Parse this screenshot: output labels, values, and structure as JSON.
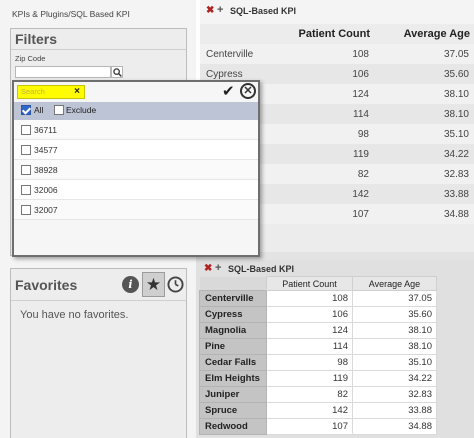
{
  "breadcrumb": "KPIs & Plugins/SQL Based KPI",
  "filters": {
    "title": "Filters",
    "zip_label": "Zip Code",
    "zip_value": ""
  },
  "popup": {
    "search_placeholder": "Search",
    "all_label": "All",
    "exclude_label": "Exclude",
    "all_checked": true,
    "exclude_checked": false,
    "items": [
      "36711",
      "34577",
      "38928",
      "32006",
      "32007"
    ]
  },
  "favorites": {
    "title": "Favorites",
    "empty_text": "You have no favorites."
  },
  "kpi_top": {
    "title": "SQL-Based KPI",
    "columns": [
      "Patient Count",
      "Average Age"
    ],
    "rows": [
      {
        "city": "Centerville",
        "count": "108",
        "age": "37.05"
      },
      {
        "city": "Cypress",
        "count": "106",
        "age": "35.60"
      },
      {
        "city": "",
        "count": "124",
        "age": "38.10"
      },
      {
        "city": "",
        "count": "114",
        "age": "38.10"
      },
      {
        "city": "",
        "count": "98",
        "age": "35.10"
      },
      {
        "city": "",
        "count": "119",
        "age": "34.22"
      },
      {
        "city": "",
        "count": "82",
        "age": "32.83"
      },
      {
        "city": "",
        "count": "142",
        "age": "33.88"
      },
      {
        "city": "",
        "count": "107",
        "age": "34.88"
      }
    ]
  },
  "kpi_bottom": {
    "title": "SQL-Based KPI",
    "columns": [
      "Patient Count",
      "Average Age"
    ],
    "rows": [
      {
        "city": "Centerville",
        "count": "108",
        "age": "37.05"
      },
      {
        "city": "Cypress",
        "count": "106",
        "age": "35.60"
      },
      {
        "city": "Magnolia",
        "count": "124",
        "age": "38.10"
      },
      {
        "city": "Pine",
        "count": "114",
        "age": "38.10"
      },
      {
        "city": "Cedar Falls",
        "count": "98",
        "age": "35.10"
      },
      {
        "city": "Elm Heights",
        "count": "119",
        "age": "34.22"
      },
      {
        "city": "Juniper",
        "count": "82",
        "age": "32.83"
      },
      {
        "city": "Spruce",
        "count": "142",
        "age": "33.88"
      },
      {
        "city": "Redwood",
        "count": "107",
        "age": "34.88"
      }
    ]
  },
  "icons": {
    "close": "close-x-icon",
    "move": "move-plus-icon",
    "search": "search-icon",
    "info": "info-icon",
    "star": "star-icon",
    "clock": "clock-icon",
    "apply": "checkmark-icon",
    "popup_close": "circle-close-icon"
  },
  "colors": {
    "search_highlight": "#fffb00",
    "toolbar_bg": "#bdc4d6",
    "close_red": "#b22222",
    "checkbox_blue": "#3266c8"
  }
}
